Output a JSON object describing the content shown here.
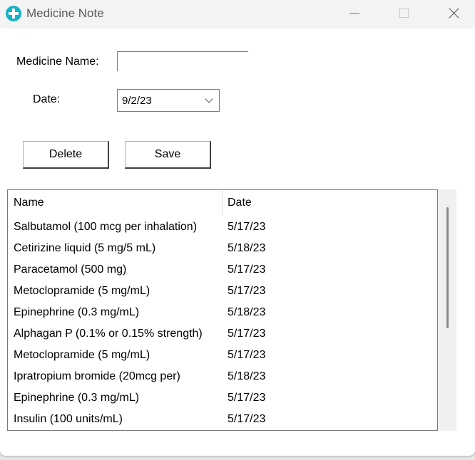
{
  "window": {
    "title": "Medicine Note"
  },
  "form": {
    "name_label": "Medicine Name:",
    "name_value": "",
    "date_label": "Date:",
    "date_value": "9/2/23"
  },
  "buttons": {
    "delete_label": "Delete",
    "save_label": "Save"
  },
  "list": {
    "columns": [
      "Name",
      "Date"
    ],
    "rows": [
      {
        "name": "Salbutamol (100 mcg per inhalation)",
        "date": "5/17/23"
      },
      {
        "name": "Cetirizine liquid (5 mg/5 mL)",
        "date": "5/18/23"
      },
      {
        "name": "Paracetamol (500 mg)",
        "date": "5/17/23"
      },
      {
        "name": "Metoclopramide (5 mg/mL)",
        "date": "5/17/23"
      },
      {
        "name": "Epinephrine (0.3 mg/mL)",
        "date": "5/18/23"
      },
      {
        "name": "Alphagan P (0.1% or 0.15% strength)",
        "date": "5/17/23"
      },
      {
        "name": "Metoclopramide (5 mg/mL)",
        "date": "5/17/23"
      },
      {
        "name": "Ipratropium bromide (20mcg per)",
        "date": "5/18/23"
      },
      {
        "name": "Epinephrine (0.3 mg/mL)",
        "date": "5/17/23"
      },
      {
        "name": "Insulin (100 units/mL)",
        "date": "5/17/23"
      }
    ]
  },
  "colors": {
    "accent_icon": "#16b2c6",
    "titlebar_bg": "#f3f3f3"
  },
  "icons": {
    "app": "medical-cross-icon",
    "dropdown": "chevron-down-icon"
  }
}
